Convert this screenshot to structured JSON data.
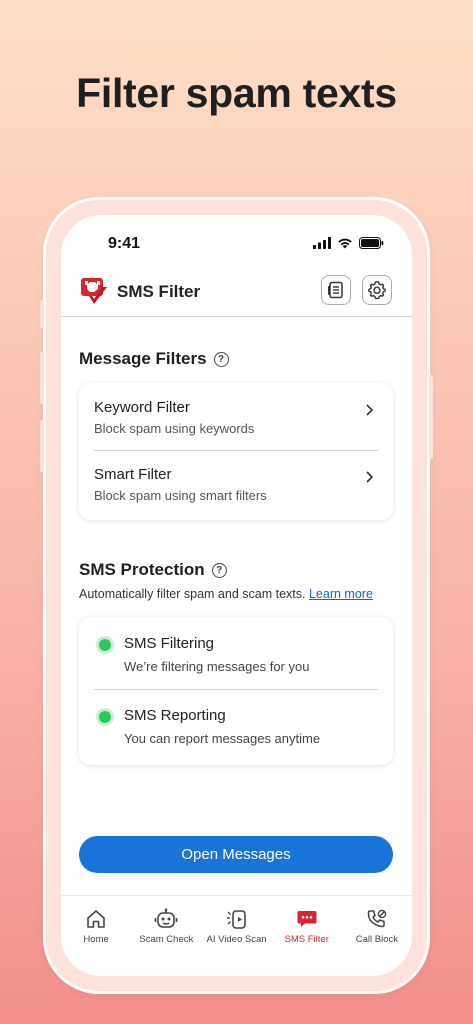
{
  "headline": "Filter spam texts",
  "status": {
    "time": "9:41"
  },
  "app": {
    "title": "SMS Filter"
  },
  "message_filters": {
    "title": "Message Filters",
    "items": [
      {
        "title": "Keyword Filter",
        "subtitle": "Block spam using keywords"
      },
      {
        "title": "Smart Filter",
        "subtitle": "Block spam using smart filters"
      }
    ]
  },
  "sms_protection": {
    "title": "SMS Protection",
    "description": "Automatically filter spam and scam texts.",
    "learn_more": "Learn more",
    "status_color": "#2ec45e",
    "items": [
      {
        "title": "SMS Filtering",
        "subtitle": "We’re filtering messages for you"
      },
      {
        "title": "SMS Reporting",
        "subtitle": "You can report messages anytime"
      }
    ]
  },
  "open_button": "Open Messages",
  "tabs": [
    {
      "label": "Home",
      "icon": "home-icon"
    },
    {
      "label": "Scam Check",
      "icon": "robot-icon"
    },
    {
      "label": "AI Video Scan",
      "icon": "video-scan-icon"
    },
    {
      "label": "SMS Filter",
      "icon": "sms-icon",
      "active": true
    },
    {
      "label": "Call Block",
      "icon": "call-block-icon"
    }
  ],
  "colors": {
    "accent": "#1a73d9",
    "brand_red": "#d9232d"
  }
}
